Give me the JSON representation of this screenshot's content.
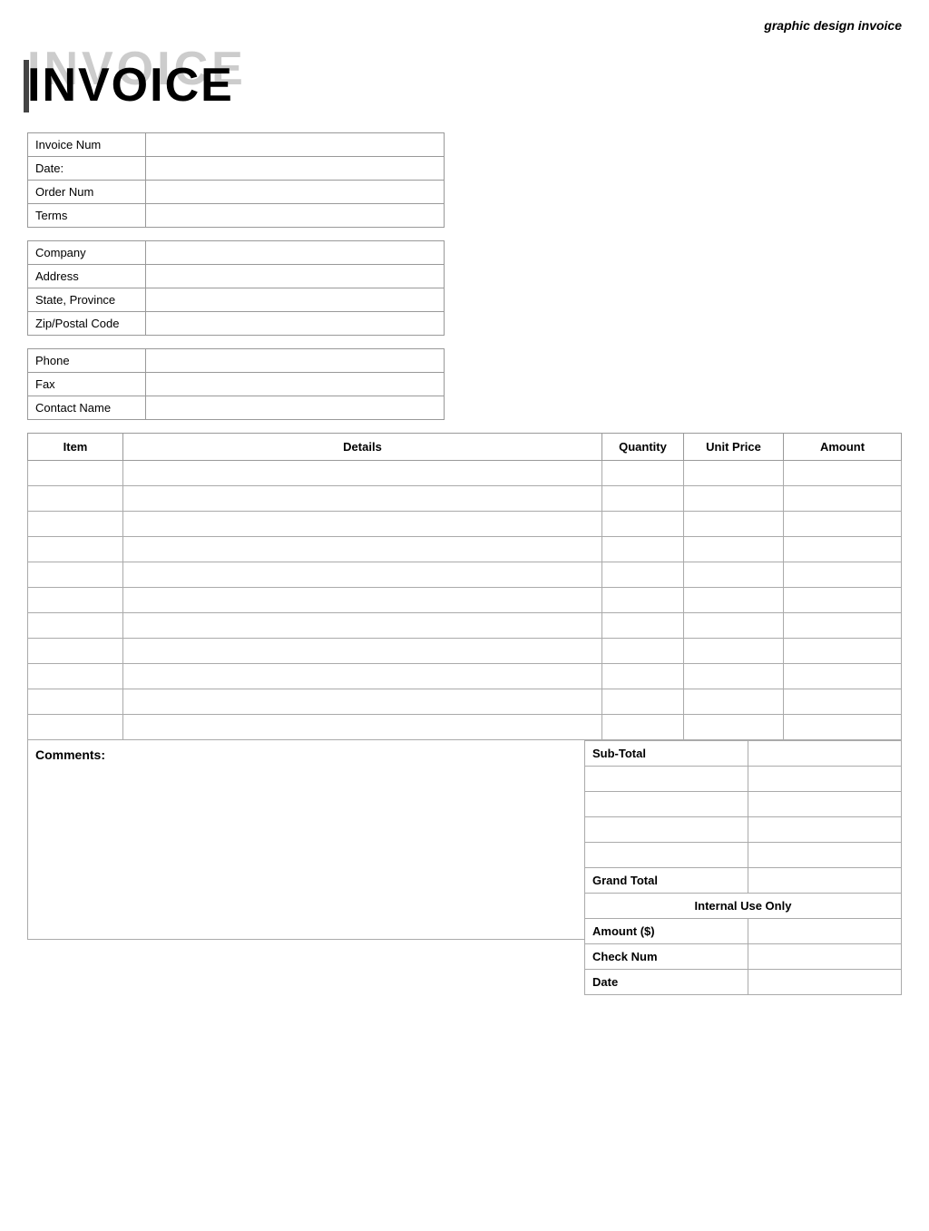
{
  "header": {
    "title": "graphic design invoice"
  },
  "invoice_title": "INVOICE",
  "info_table_1": {
    "rows": [
      {
        "label": "Invoice Num",
        "value": ""
      },
      {
        "label": "Date:",
        "value": ""
      },
      {
        "label": "Order Num",
        "value": ""
      },
      {
        "label": "Terms",
        "value": ""
      }
    ]
  },
  "info_table_2": {
    "rows": [
      {
        "label": "Company",
        "value": ""
      },
      {
        "label": "Address",
        "value": ""
      },
      {
        "label": "State, Province",
        "value": ""
      },
      {
        "label": "Zip/Postal Code",
        "value": ""
      }
    ]
  },
  "info_table_3": {
    "rows": [
      {
        "label": "Phone",
        "value": ""
      },
      {
        "label": "Fax",
        "value": ""
      },
      {
        "label": "Contact Name",
        "value": ""
      }
    ]
  },
  "items_table": {
    "headers": {
      "item": "Item",
      "details": "Details",
      "quantity": "Quantity",
      "unit_price": "Unit Price",
      "amount": "Amount"
    },
    "rows": 11
  },
  "comments_label": "Comments:",
  "totals": {
    "subtotal_label": "Sub-Total",
    "subtotal_value": "",
    "extra_rows": 4,
    "grand_total_label": "Grand Total",
    "grand_total_value": "",
    "internal_use_label": "Internal Use Only",
    "internal_rows": [
      {
        "label": "Amount ($)",
        "value": ""
      },
      {
        "label": "Check Num",
        "value": ""
      },
      {
        "label": "Date",
        "value": ""
      }
    ]
  }
}
